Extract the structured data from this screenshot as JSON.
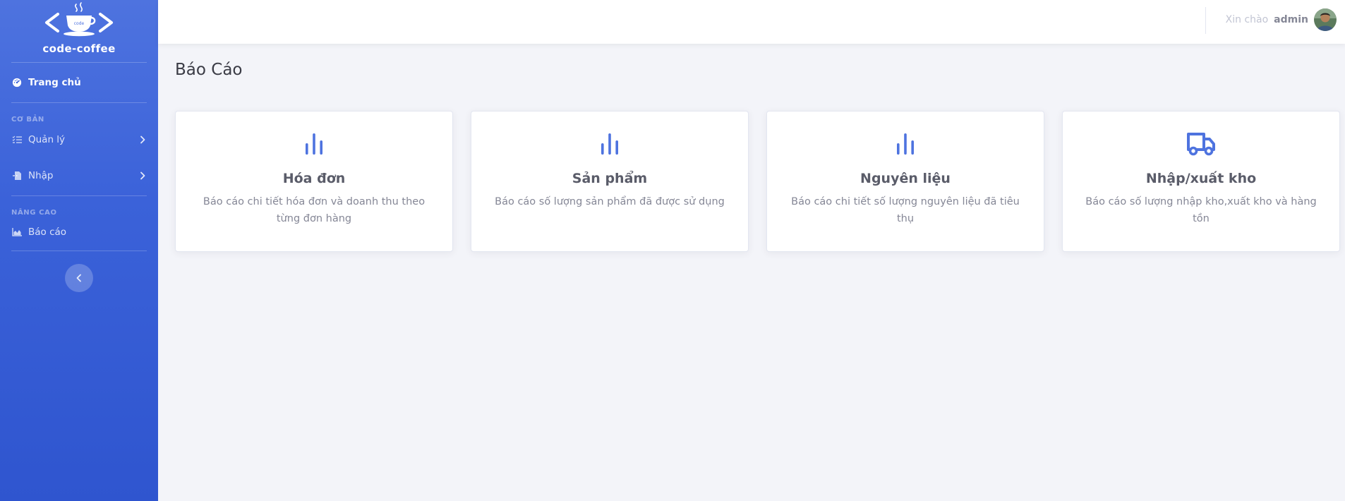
{
  "brand": {
    "name": "code-coffee",
    "logo_cup_text": "code"
  },
  "sidebar": {
    "home_label": "Trang chủ",
    "section_basic": "CƠ BẢN",
    "manage_label": "Quản lý",
    "import_label": "Nhập",
    "section_advanced": "NÂNG CAO",
    "report_label": "Báo cáo"
  },
  "topbar": {
    "greeting": "Xin chào",
    "username": "admin"
  },
  "page": {
    "title": "Báo Cáo"
  },
  "cards": [
    {
      "title": "Hóa đơn",
      "description": "Báo cáo chi tiết hóa đơn và doanh thu theo từng đơn hàng",
      "icon": "bar-chart-icon"
    },
    {
      "title": "Sản phẩm",
      "description": "Báo cáo số lượng sản phẩm đã được sử dụng",
      "icon": "bar-chart-icon"
    },
    {
      "title": "Nguyên liệu",
      "description": "Báo cáo chi tiết số lượng nguyên liệu đã tiêu thụ",
      "icon": "bar-chart-icon"
    },
    {
      "title": "Nhập/xuất kho",
      "description": "Báo cáo số lượng nhập kho,xuất kho và hàng tồn",
      "icon": "truck-icon"
    }
  ],
  "colors": {
    "primary": "#4e73df",
    "sidebar_bottom": "#2f55cf",
    "background": "#f3f4f9"
  }
}
